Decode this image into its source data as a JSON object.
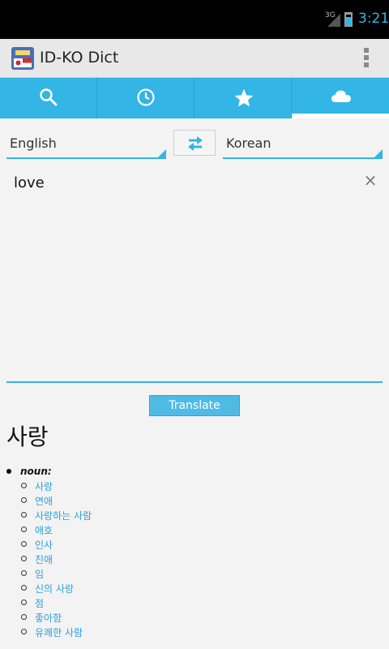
{
  "status_bar": {
    "network": "3G",
    "time": "3:21"
  },
  "action_bar": {
    "title": "ID-KO Dict"
  },
  "tabs": [
    {
      "name": "search",
      "icon": "search-icon"
    },
    {
      "name": "history",
      "icon": "clock-icon"
    },
    {
      "name": "favorites",
      "icon": "star-icon"
    },
    {
      "name": "online",
      "icon": "cloud-icon",
      "active": true
    }
  ],
  "languages": {
    "source": "English",
    "target": "Korean"
  },
  "input": {
    "text": "love"
  },
  "translate_button": "Translate",
  "result": {
    "headword": "사랑",
    "pos": "noun:",
    "translations": [
      "사랑",
      "연애",
      "사랑하는 사람",
      "애호",
      "인사",
      "친애",
      "임",
      "신의 사랑",
      "점",
      "좋아함",
      "유쾌한 사람"
    ]
  },
  "colors": {
    "accent": "#33b5e5",
    "link": "#2d9fd6"
  }
}
